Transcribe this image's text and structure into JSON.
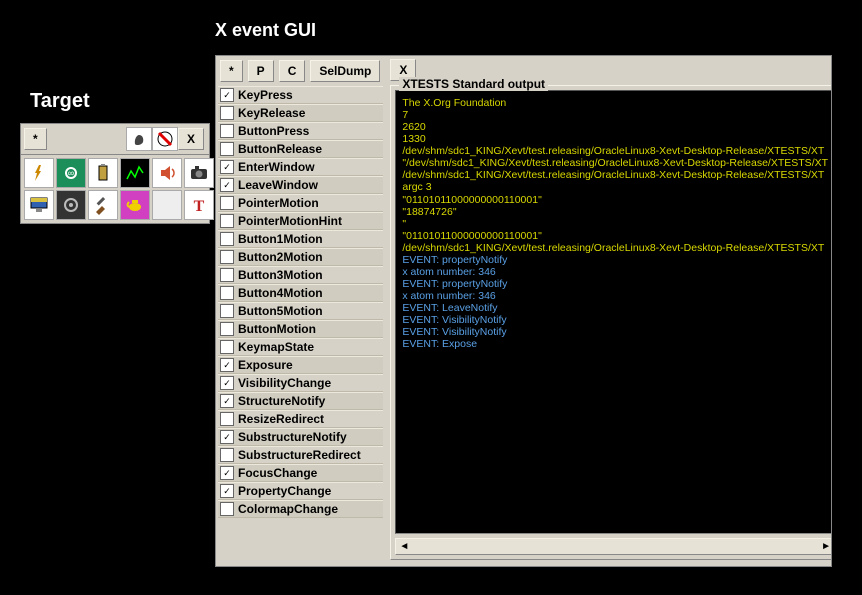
{
  "target": {
    "title": "Target",
    "star_btn": "*",
    "x_btn": "X",
    "icons": [
      "hand-icon",
      "gear-icon",
      "battery-icon",
      "chart-icon",
      "sound-icon",
      "camera-icon",
      "monitor-icon",
      "cog-icon",
      "brush-icon",
      "teapot-icon",
      "blank-icon",
      "text-icon"
    ],
    "top_icons": [
      "foot-icon",
      "red-cross-icon"
    ]
  },
  "main": {
    "title": "X event GUI",
    "toolbar": {
      "star": "*",
      "p": "P",
      "c": "C",
      "seldump": "SelDump"
    }
  },
  "events": [
    {
      "label": "KeyPress",
      "checked": true
    },
    {
      "label": "KeyRelease",
      "checked": false
    },
    {
      "label": "ButtonPress",
      "checked": false
    },
    {
      "label": "ButtonRelease",
      "checked": false
    },
    {
      "label": "EnterWindow",
      "checked": true
    },
    {
      "label": "LeaveWindow",
      "checked": true
    },
    {
      "label": "PointerMotion",
      "checked": false
    },
    {
      "label": "PointerMotionHint",
      "checked": false
    },
    {
      "label": "Button1Motion",
      "checked": false
    },
    {
      "label": "Button2Motion",
      "checked": false
    },
    {
      "label": "Button3Motion",
      "checked": false
    },
    {
      "label": "Button4Motion",
      "checked": false
    },
    {
      "label": "Button5Motion",
      "checked": false
    },
    {
      "label": "ButtonMotion",
      "checked": false
    },
    {
      "label": "KeymapState",
      "checked": false
    },
    {
      "label": "Exposure",
      "checked": true
    },
    {
      "label": "VisibilityChange",
      "checked": true
    },
    {
      "label": "StructureNotify",
      "checked": true
    },
    {
      "label": "ResizeRedirect",
      "checked": false
    },
    {
      "label": "SubstructureNotify",
      "checked": true
    },
    {
      "label": "SubstructureRedirect",
      "checked": false
    },
    {
      "label": "FocusChange",
      "checked": true
    },
    {
      "label": "PropertyChange",
      "checked": true
    },
    {
      "label": "ColormapChange",
      "checked": false
    }
  ],
  "output": {
    "close_btn": "X",
    "legend": "XTESTS Standard output",
    "lines": [
      {
        "t": "",
        "c": "y"
      },
      {
        "t": "The X.Org Foundation",
        "c": "y"
      },
      {
        "t": "7",
        "c": "y"
      },
      {
        "t": "2620",
        "c": "y"
      },
      {
        "t": "1330",
        "c": "y"
      },
      {
        "t": "/dev/shm/sdc1_KING/Xevt/test.releasing/OracleLinux8-Xevt-Desktop-Release/XTESTS/XT",
        "c": "y"
      },
      {
        "t": "\"/dev/shm/sdc1_KING/Xevt/test.releasing/OracleLinux8-Xevt-Desktop-Release/XTESTS/XT",
        "c": "y"
      },
      {
        "t": "/dev/shm/sdc1_KING/Xevt/test.releasing/OracleLinux8-Xevt-Desktop-Release/XTESTS/XT",
        "c": "y"
      },
      {
        "t": "argc 3",
        "c": "y"
      },
      {
        "t": "",
        "c": "y"
      },
      {
        "t": "\"01101011000000000110001\"",
        "c": "y"
      },
      {
        "t": "",
        "c": "y"
      },
      {
        "t": "\"18874726\"",
        "c": "y"
      },
      {
        "t": "\"",
        "c": "y"
      },
      {
        "t": "\"01101011000000000110001\"",
        "c": "y"
      },
      {
        "t": "/dev/shm/sdc1_KING/Xevt/test.releasing/OracleLinux8-Xevt-Desktop-Release/XTESTS/XT",
        "c": "y"
      },
      {
        "t": "EVENT: propertyNotify",
        "c": "b"
      },
      {
        "t": "x atom number: 346",
        "c": "b"
      },
      {
        "t": "EVENT: propertyNotify",
        "c": "b"
      },
      {
        "t": "x atom number: 346",
        "c": "b"
      },
      {
        "t": "EVENT: LeaveNotify",
        "c": "b"
      },
      {
        "t": "EVENT: VisibilityNotify",
        "c": "b"
      },
      {
        "t": "EVENT: VisibilityNotify",
        "c": "b"
      },
      {
        "t": "EVENT: Expose",
        "c": "b"
      }
    ],
    "scroll_left": "◄",
    "scroll_right": "►"
  }
}
